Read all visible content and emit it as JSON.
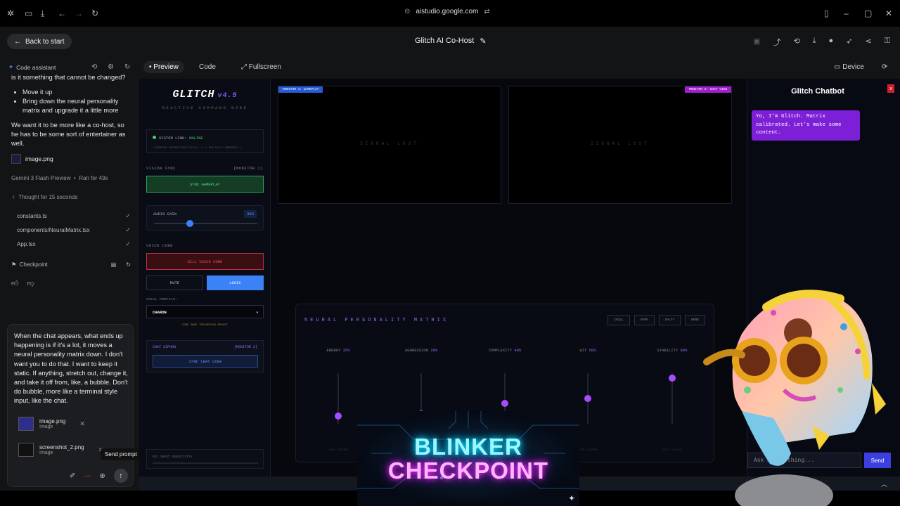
{
  "browser": {
    "url": "aistudio.google.com"
  },
  "header": {
    "back_label": "Back to start",
    "title": "Glitch AI Co-Host"
  },
  "assistant": {
    "title": "Code assistant",
    "history": {
      "prev_text": "is it something that cannot be changed?",
      "bullets": [
        "Move it up",
        "Bring down the neural personality matrix and upgrade it a little more"
      ],
      "paragraph": "We want it to be more like a co-host, so he has to be some sort of entertainer as well.",
      "image_name": "image.png",
      "model": "Gemini 3 Flash Preview",
      "ran": "Ran for 49s",
      "thought": "Thought for 15 seconds",
      "files": [
        "constants.ts",
        "components/NeuralMatrix.tsx",
        "App.tsx"
      ],
      "checkpoint": "Checkpoint"
    },
    "prompt": {
      "text": "When the chat appears, what ends up happening is if it's a lot, it moves a neural personality matrix down. I don't want you to do that. I want to keep it static. If anything, stretch out, change it, and take it off from, like, a bubble. Don't do bubble, more like a terminal style input, like the chat.",
      "attachments": [
        {
          "name": "image.png",
          "type": "Image"
        },
        {
          "name": "screenshot_2.png",
          "type": "Image"
        }
      ],
      "tooltip": "Send prompt"
    }
  },
  "preview_toolbar": {
    "tabs": [
      "Preview",
      "Code",
      "Fullscreen"
    ],
    "device": "Device"
  },
  "glitch_app": {
    "logo": "GLITCH",
    "version": "v4.5",
    "subtitle": "REACTIVE COMMAND NODE",
    "system_link_label": "SYSTEM LINK:",
    "system_link_status": "ONLINE",
    "log_line": "**PRIMING INTERACTION STYLE** // ▸ NOW FULLY IMMERSED I...",
    "vision_sync": "VISION SYNC",
    "vision_monitor": "[MONITOR 1]",
    "sync_gameplay": "SYNC GAMEPLAY",
    "audio_gain": "AUDIO GAIN",
    "audio_gain_value": "35%",
    "audio_gain_level": 0.35,
    "voice_core": "VOICE CORE",
    "kill_voice": "KILL VOICE CORE",
    "mute": "MUTE",
    "logic": "LOGIC",
    "vocal_profile": "VOCAL PROFILE:",
    "vocal_value": "CHARON",
    "core_msg": "CORE SWAP TRIGGERING REBOOT",
    "chat_siphon": "CHAT SIPHON",
    "siphon_monitor": "[MONITOR 2]",
    "sync_chat": "SYNC CHAT VIEW",
    "mic_input": "MIC INPUT SENSITIVITY",
    "monitor1": "MONITOR 1: GAMEPLAY",
    "monitor2": "MONITOR 2: CHAT VIEW",
    "signal_lost": "SIGNAL LOST",
    "matrix": {
      "title": "NEURAL PERSONALITY MATRIX",
      "chips": [
        "CHILL",
        "HYPE",
        "SALTY",
        "NERD"
      ],
      "traits": [
        {
          "name": "ENERGY",
          "value": "15%",
          "level": 0.15
        },
        {
          "name": "AGGRESSION",
          "value": "20%",
          "level": 0.2
        },
        {
          "name": "COMPLEXITY",
          "value": "40%",
          "level": 0.4
        },
        {
          "name": "WIT",
          "value": "50%",
          "level": 0.5
        },
        {
          "name": "STABILITY",
          "value": "90%",
          "level": 0.9
        }
      ],
      "level_control": "LEVEL CONTROL"
    },
    "chatbot": {
      "title": "Glitch Chatbot",
      "close": "x",
      "message": "Yo, I'm Glitch. Matrix calibrated. Let's make some content.",
      "placeholder": "Ask me anything...",
      "send": "Send"
    }
  },
  "overlay": {
    "line1": "BLINKER",
    "line2": "CHECKPOINT"
  },
  "colors": {
    "accent_purple": "#7c1fd6",
    "accent_blue": "#3b82f6",
    "online_green": "#3ecf6b",
    "danger_red": "#ff4d5e"
  }
}
